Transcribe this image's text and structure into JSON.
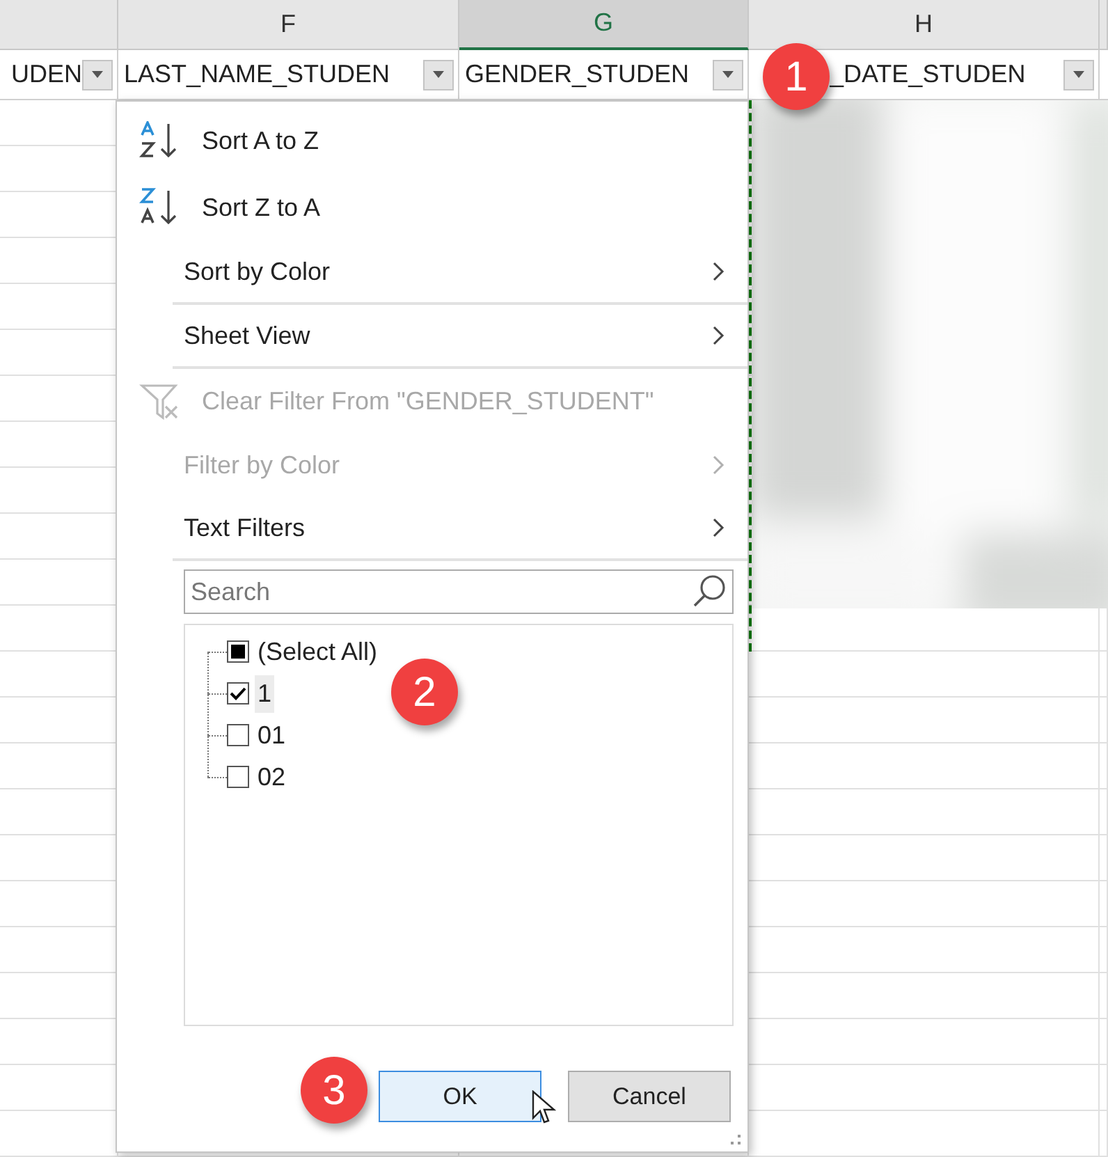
{
  "column_letters": [
    {
      "selected": false
    },
    {
      "letter": "F",
      "selected": false
    },
    {
      "letter": "G",
      "selected": true
    },
    {
      "letter": "H",
      "selected": false
    },
    {
      "selected": false
    }
  ],
  "filter_headers": [
    {
      "label": "UDEN"
    },
    {
      "label": "LAST_NAME_STUDEN"
    },
    {
      "label": "GENDER_STUDEN"
    },
    {
      "label": "_DATE_STUDEN"
    }
  ],
  "filter_menu": {
    "items": [
      {
        "kind": "sort-asc",
        "label": "Sort A to Z",
        "disabled": false,
        "submenu": false,
        "divider_after": false
      },
      {
        "kind": "sort-desc",
        "label": "Sort Z to A",
        "disabled": false,
        "submenu": false,
        "divider_after": false
      },
      {
        "kind": "plain",
        "label": "Sort by Color",
        "disabled": false,
        "submenu": true,
        "divider_after": true
      },
      {
        "kind": "plain",
        "label": "Sheet View",
        "disabled": false,
        "submenu": true,
        "divider_after": true
      },
      {
        "kind": "clear-filter",
        "label": "Clear Filter From \"GENDER_STUDENT\"",
        "disabled": true,
        "submenu": false,
        "divider_after": false
      },
      {
        "kind": "plain",
        "label": "Filter by Color",
        "disabled": true,
        "submenu": true,
        "divider_after": false
      },
      {
        "kind": "plain",
        "label": "Text Filters",
        "disabled": false,
        "submenu": true,
        "divider_after": true
      }
    ],
    "search": {
      "placeholder": "Search"
    },
    "values": [
      {
        "label": "(Select All)",
        "checked": false,
        "mixed": true,
        "selected": false
      },
      {
        "label": "1",
        "checked": true,
        "mixed": false,
        "selected": true
      },
      {
        "label": "01",
        "checked": false,
        "mixed": false,
        "selected": false
      },
      {
        "label": "02",
        "checked": false,
        "mixed": false,
        "selected": false
      }
    ],
    "buttons": [
      {
        "label": "OK",
        "selected": true
      },
      {
        "label": "Cancel",
        "selected": false
      }
    ]
  },
  "step_badges": [
    "1",
    "2",
    "3"
  ]
}
